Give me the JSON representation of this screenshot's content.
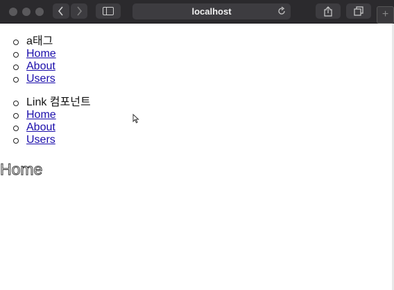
{
  "browser": {
    "address": "localhost",
    "icons": {
      "back": "chevron-left-icon",
      "forward": "chevron-right-icon",
      "sidebar": "sidebar-icon",
      "reload": "reload-icon",
      "share": "share-icon",
      "tabs": "tabs-icon",
      "new_tab": "plus-icon"
    }
  },
  "page": {
    "a_tag_list": {
      "caption": "a태그",
      "links": [
        "Home",
        "About",
        "Users"
      ]
    },
    "link_component_list": {
      "caption": "Link 컴포넌트",
      "links": [
        "Home",
        "About",
        "Users"
      ]
    },
    "heading": "Home"
  }
}
